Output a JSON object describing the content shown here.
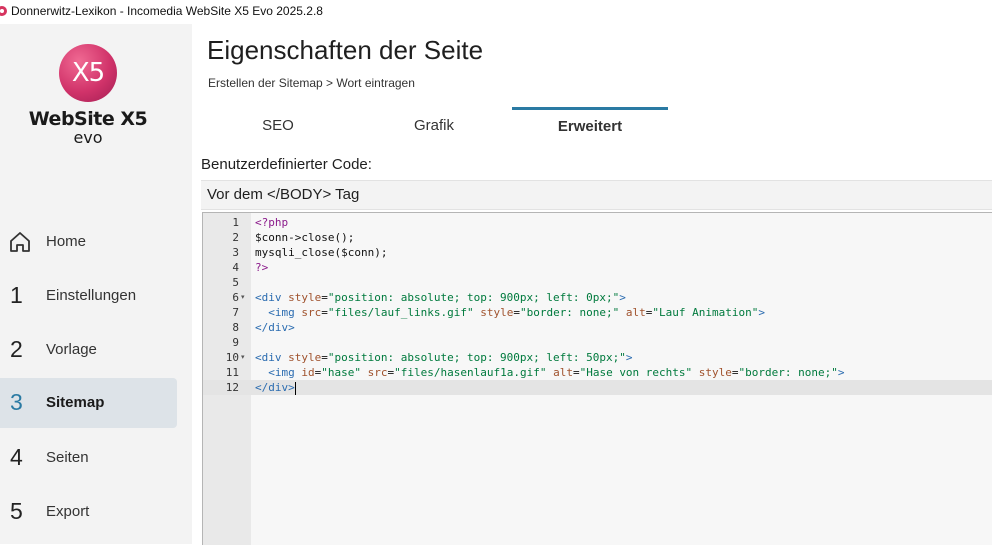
{
  "window": {
    "title": "Donnerwitz-Lexikon - Incomedia WebSite X5 Evo 2025.2.8"
  },
  "logo": {
    "mark": "X5",
    "name": "WebSite X5",
    "edition": "evo"
  },
  "sidebar": {
    "items": [
      {
        "num": "",
        "label": "Home",
        "icon": "home-icon"
      },
      {
        "num": "1",
        "label": "Einstellungen"
      },
      {
        "num": "2",
        "label": "Vorlage"
      },
      {
        "num": "3",
        "label": "Sitemap",
        "active": true
      },
      {
        "num": "4",
        "label": "Seiten"
      },
      {
        "num": "5",
        "label": "Export"
      }
    ]
  },
  "header": {
    "title": "Eigenschaften der Seite",
    "breadcrumb": "Erstellen der Sitemap > Wort eintragen"
  },
  "tabs": [
    {
      "label": "SEO"
    },
    {
      "label": "Grafik"
    },
    {
      "label": "Erweitert",
      "active": true
    }
  ],
  "custom_code": {
    "label": "Benutzerdefinierter Code:",
    "position": "Vor dem </BODY> Tag"
  },
  "editor": {
    "lines": [
      {
        "n": "1",
        "text": "<?php"
      },
      {
        "n": "2",
        "text": "$conn->close();"
      },
      {
        "n": "3",
        "text": "mysqli_close($conn);"
      },
      {
        "n": "4",
        "text": "?>"
      },
      {
        "n": "5",
        "text": ""
      },
      {
        "n": "6",
        "text": "<div style=\"position: absolute; top: 900px; left: 0px;\">",
        "fold": true
      },
      {
        "n": "7",
        "text": "  <img src=\"files/lauf_links.gif\" style=\"border: none;\" alt=\"Lauf Animation\">"
      },
      {
        "n": "8",
        "text": "</div>"
      },
      {
        "n": "9",
        "text": ""
      },
      {
        "n": "10",
        "text": "<div style=\"position: absolute; top: 900px; left: 50px;\">",
        "fold": true
      },
      {
        "n": "11",
        "text": "  <img id=\"hase\" src=\"files/hasenlauf1a.gif\" alt=\"Hase von rechts\" style=\"border: none;\">"
      },
      {
        "n": "12",
        "text": "</div>",
        "current": true
      }
    ],
    "colors": {
      "tag": "#2b6cb0",
      "attr": "#a0522d",
      "string": "#007a3d",
      "php": "#8b1a8b"
    }
  }
}
